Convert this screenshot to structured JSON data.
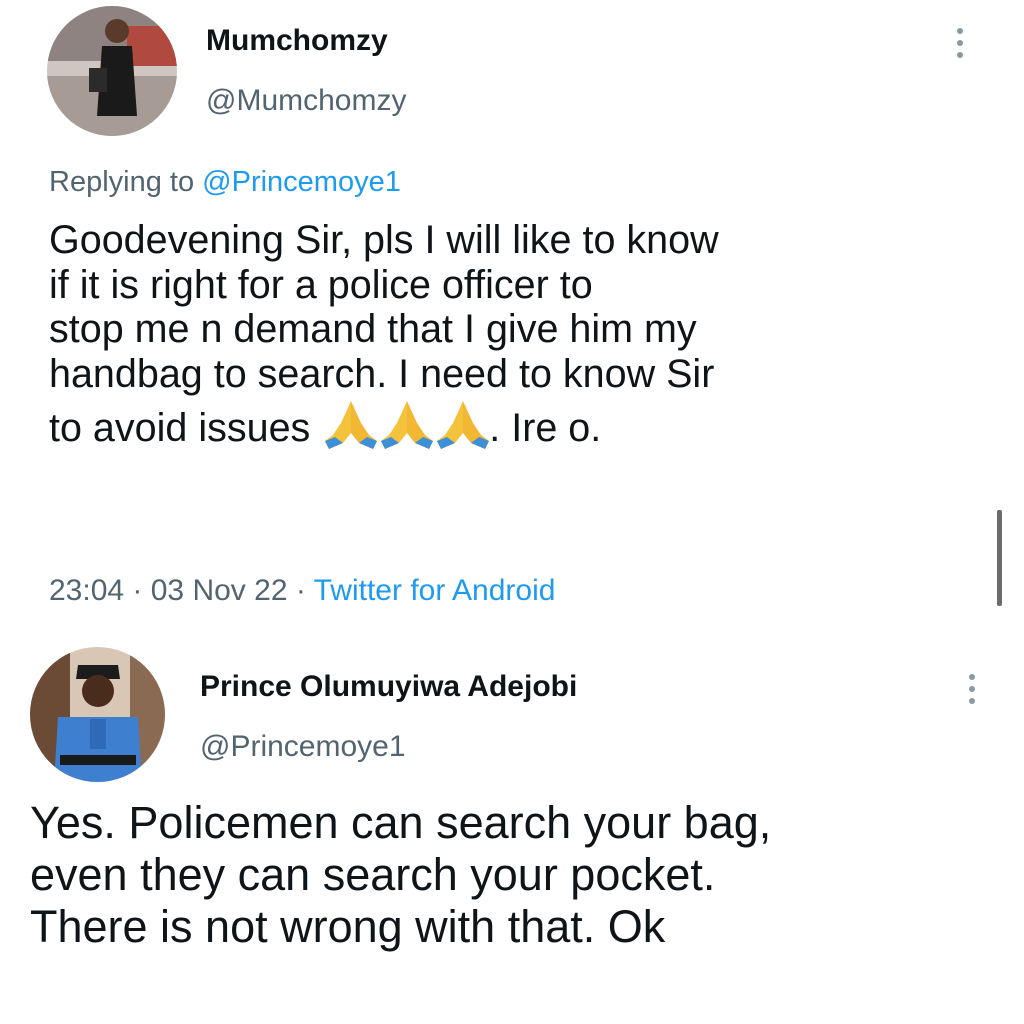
{
  "tweet1": {
    "name": "Mumchomzy",
    "handle": "@Mumchomzy",
    "replying_prefix": "Replying to ",
    "replying_to": "@Princemoye1",
    "text_lines": [
      "Goodevening Sir, pls I will like to know",
      "if it is right for a police officer to",
      "stop me n demand that I give him my",
      "handbag to search. I need to know Sir"
    ],
    "last_line_start": "to avoid issues ",
    "emoji": "folded-hands-emoji x3",
    "last_line_end": ". Ire o.",
    "time": "23:04",
    "sep1": " · ",
    "date": "03 Nov 22",
    "sep2": " · ",
    "source": "Twitter for Android"
  },
  "tweet2": {
    "name": "Prince Olumuyiwa Adejobi",
    "handle": "@Princemoye1",
    "text_lines": [
      "Yes. Policemen can search your bag,",
      "even they can search your pocket.",
      "There is not wrong with that. Ok"
    ]
  },
  "icons": {
    "more": "more-vertical-icon",
    "emoji": "folded-hands-emoji"
  },
  "colors": {
    "text": "#0f1419",
    "secondary": "#536471",
    "link": "#1d9bf0"
  }
}
